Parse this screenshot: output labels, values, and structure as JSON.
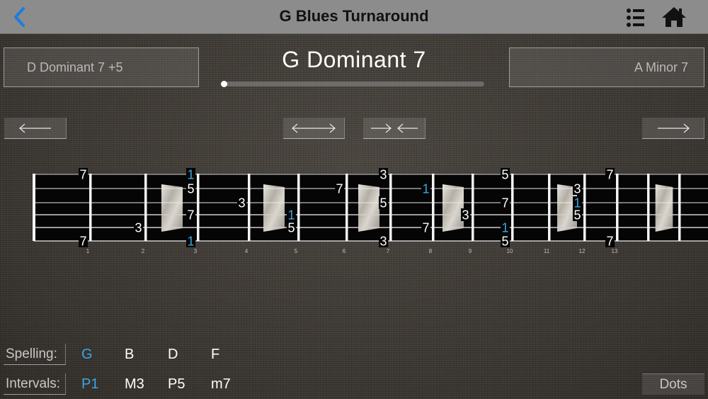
{
  "nav": {
    "title": "G Blues Turnaround",
    "back_icon": "chevron-left-icon",
    "list_icon": "list-icon",
    "home_icon": "home-icon",
    "accent_color": "#1e7be0"
  },
  "chord": {
    "prev_label": "D  Dominant 7 +5",
    "current_label": "G  Dominant 7",
    "next_label": "A  Minor 7",
    "progress": 0.0
  },
  "arrows": {
    "left_icon": "arrow-left-icon",
    "expand_icon": "arrows-expand-icon",
    "contract_icon": "arrows-contract-icon",
    "right_icon": "arrow-right-icon"
  },
  "fretboard": {
    "fret_numbers": [
      "1",
      "2",
      "3",
      "4",
      "5",
      "6",
      "7",
      "8",
      "9",
      "10",
      "11",
      "12",
      "13"
    ],
    "inlay_frets": [
      3,
      5,
      7,
      9,
      12,
      15
    ],
    "root_color": "#3aa7e6",
    "note_color": "#ffffff",
    "notes": [
      {
        "fret": 1,
        "string": 6,
        "label": "7",
        "root": false
      },
      {
        "fret": 1,
        "string": 1,
        "label": "7",
        "root": false
      },
      {
        "fret": 2,
        "string": 5,
        "label": "3",
        "root": false
      },
      {
        "fret": 3,
        "string": 6,
        "label": "1",
        "root": true
      },
      {
        "fret": 3,
        "string": 1,
        "label": "1",
        "root": true
      },
      {
        "fret": 3,
        "string": 2,
        "label": "5",
        "root": false
      },
      {
        "fret": 3,
        "string": 4,
        "label": "7",
        "root": false
      },
      {
        "fret": 4,
        "string": 3,
        "label": "3",
        "root": false
      },
      {
        "fret": 5,
        "string": 4,
        "label": "1",
        "root": true
      },
      {
        "fret": 5,
        "string": 5,
        "label": "5",
        "root": false
      },
      {
        "fret": 6,
        "string": 2,
        "label": "7",
        "root": false
      },
      {
        "fret": 7,
        "string": 1,
        "label": "3",
        "root": false
      },
      {
        "fret": 7,
        "string": 3,
        "label": "5",
        "root": false
      },
      {
        "fret": 7,
        "string": 6,
        "label": "3",
        "root": false
      },
      {
        "fret": 8,
        "string": 2,
        "label": "1",
        "root": true
      },
      {
        "fret": 8,
        "string": 5,
        "label": "7",
        "root": false
      },
      {
        "fret": 9,
        "string": 4,
        "label": "3",
        "root": false
      },
      {
        "fret": 10,
        "string": 1,
        "label": "5",
        "root": false
      },
      {
        "fret": 10,
        "string": 3,
        "label": "7",
        "root": false
      },
      {
        "fret": 10,
        "string": 5,
        "label": "1",
        "root": true
      },
      {
        "fret": 10,
        "string": 6,
        "label": "5",
        "root": false
      },
      {
        "fret": 12,
        "string": 2,
        "label": "3",
        "root": false
      },
      {
        "fret": 12,
        "string": 3,
        "label": "1",
        "root": true
      },
      {
        "fret": 12,
        "string": 4,
        "label": "5",
        "root": false
      },
      {
        "fret": 13,
        "string": 1,
        "label": "7",
        "root": false
      },
      {
        "fret": 13,
        "string": 6,
        "label": "7",
        "root": false
      }
    ]
  },
  "spelling": {
    "label": "Spelling:",
    "notes": [
      {
        "text": "G",
        "root": true
      },
      {
        "text": "B",
        "root": false
      },
      {
        "text": "D",
        "root": false
      },
      {
        "text": "F",
        "root": false
      }
    ]
  },
  "intervals": {
    "label": "Intervals:",
    "items": [
      {
        "text": "P1",
        "root": true
      },
      {
        "text": "M3",
        "root": false
      },
      {
        "text": "P5",
        "root": false
      },
      {
        "text": "m7",
        "root": false
      }
    ]
  },
  "dots_label": "Dots"
}
